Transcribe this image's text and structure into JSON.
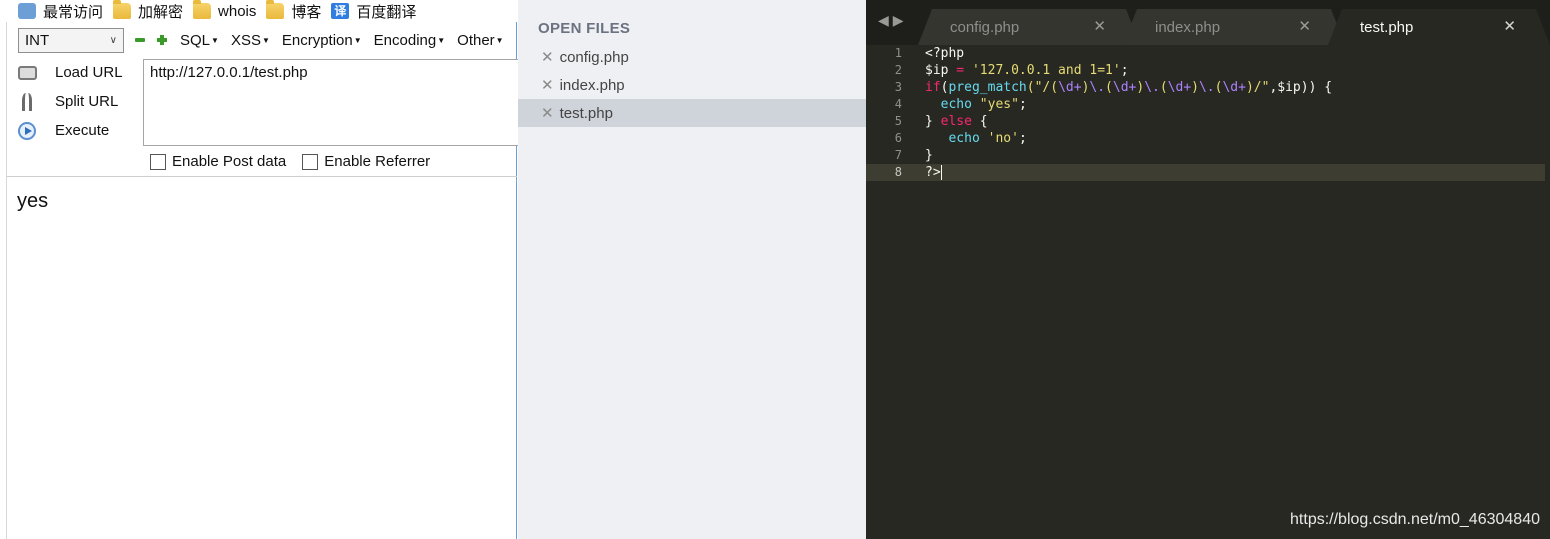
{
  "bookmarks": [
    {
      "label": "最常访问",
      "icon": "clock-icon"
    },
    {
      "label": "加解密",
      "icon": "folder-icon"
    },
    {
      "label": "whois",
      "icon": "folder-icon"
    },
    {
      "label": "博客",
      "icon": "folder-icon"
    },
    {
      "label": "百度翻译",
      "icon": "translate-icon",
      "icon_text": "译"
    }
  ],
  "hackbar": {
    "type_select": "INT",
    "menus": [
      "SQL",
      "XSS",
      "Encryption",
      "Encoding",
      "Other"
    ],
    "actions": [
      "Load URL",
      "Split URL",
      "Execute"
    ],
    "url": "http://127.0.0.1/test.php",
    "options": [
      "Enable Post data",
      "Enable Referrer"
    ]
  },
  "page_output": "yes",
  "sidebar": {
    "title": "OPEN FILES",
    "files": [
      "config.php",
      "index.php",
      "test.php"
    ],
    "active_file": "test.php"
  },
  "editor": {
    "tabs": [
      "config.php",
      "index.php",
      "test.php"
    ],
    "active_tab": "test.php",
    "line_numbers": [
      "1",
      "2",
      "3",
      "4",
      "5",
      "6",
      "7",
      "8"
    ],
    "code": {
      "l1": "<?php",
      "l2_var": "$ip",
      "l2_op": " = ",
      "l2_str": "'127.0.0.1 and 1=1'",
      "l2_end": ";",
      "l3_if": "if",
      "l3_open": "(",
      "l3_fn": "preg_match",
      "l3_q1": "(\"/",
      "l3_s1": "(",
      "l3_e1": "\\d+",
      "l3_s2": ")",
      "l3_e2": "\\.",
      "l3_s3": "(",
      "l3_e3": "\\d+",
      "l3_s4": ")",
      "l3_e4": "\\.",
      "l3_s5": "(",
      "l3_e5": "\\d+",
      "l3_s6": ")",
      "l3_e6": "\\.",
      "l3_s7": "(",
      "l3_e7": "\\d+",
      "l3_s8": ")/\"",
      "l3_rest": ",$ip)) {",
      "l4_echo": "echo",
      "l4_str": "\"yes\"",
      "l4_end": ";",
      "l5_close": "} ",
      "l5_else": "else",
      "l5_brace": " {",
      "l6_echo": "echo",
      "l6_str": "'no'",
      "l6_end": ";",
      "l7": "}",
      "l8": "?>"
    }
  },
  "watermark": "https://blog.csdn.net/m0_46304840",
  "colors": {
    "editor_bg": "#272822",
    "keyword": "#f92672",
    "function": "#66d9ef",
    "string": "#e6db74",
    "escape": "#ae81ff",
    "sidebar_bg": "#eef0f3"
  }
}
